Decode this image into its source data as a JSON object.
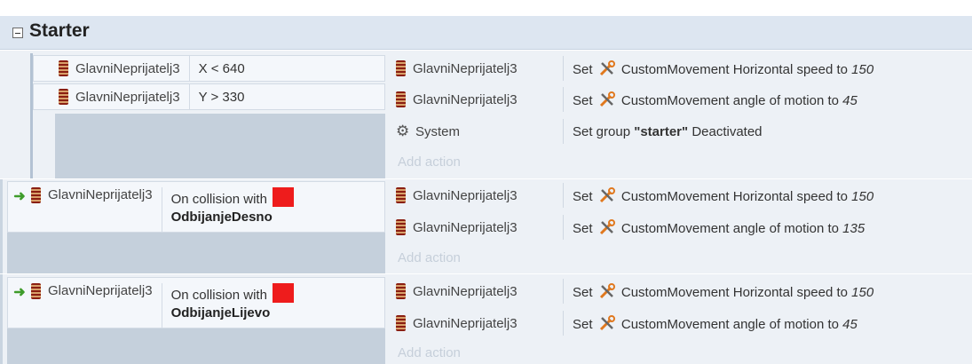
{
  "group": {
    "title": "Starter"
  },
  "blocks": [
    {
      "conditions": [
        {
          "object": "GlavniNeprijatelj3",
          "text": "X < 640"
        },
        {
          "object": "GlavniNeprijatelj3",
          "text": "Y > 330"
        }
      ],
      "actions": [
        {
          "object": "GlavniNeprijatelj3",
          "set": "Set",
          "behavior": "CustomMovement",
          "text": "Horizontal speed to",
          "param": "150"
        },
        {
          "object": "GlavniNeprijatelj3",
          "set": "Set",
          "behavior": "CustomMovement",
          "text": "angle of motion to",
          "param": "45"
        },
        {
          "object": "System",
          "pre": "Set group",
          "quoted": "\"starter\"",
          "post": "Deactivated"
        }
      ],
      "add_action": "Add action"
    },
    {
      "trigger": {
        "object": "GlavniNeprijatelj3",
        "text": "On collision with",
        "target": "OdbijanjeDesno",
        "target_color": "#ee1c1c"
      },
      "actions": [
        {
          "object": "GlavniNeprijatelj3",
          "set": "Set",
          "behavior": "CustomMovement",
          "text": "Horizontal speed to",
          "param": "150"
        },
        {
          "object": "GlavniNeprijatelj3",
          "set": "Set",
          "behavior": "CustomMovement",
          "text": "angle of motion to",
          "param": "135"
        }
      ],
      "add_action": "Add action"
    },
    {
      "trigger": {
        "object": "GlavniNeprijatelj3",
        "text": "On collision with",
        "target": "OdbijanjeLijevo",
        "target_color": "#ee1c1c"
      },
      "actions": [
        {
          "object": "GlavniNeprijatelj3",
          "set": "Set",
          "behavior": "CustomMovement",
          "text": "Horizontal speed to",
          "param": "150"
        },
        {
          "object": "GlavniNeprijatelj3",
          "set": "Set",
          "behavior": "CustomMovement",
          "text": "angle of motion to",
          "param": "45"
        }
      ],
      "add_action": "Add action"
    }
  ],
  "icons": {
    "object": "sprite-object-icon",
    "behavior": "wrench-screwdriver-icon",
    "system": "gear-icon",
    "trigger": "green-arrow-icon"
  }
}
